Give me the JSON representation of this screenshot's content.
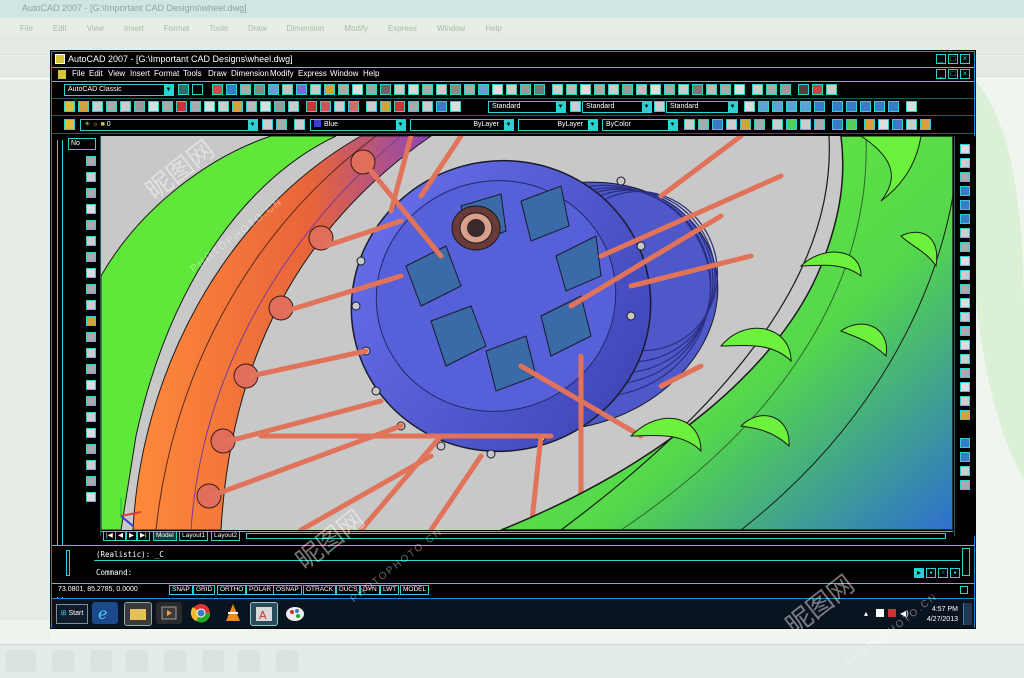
{
  "window": {
    "title": "AutoCAD 2007 - [G:\\Important CAD Designs\\wheel.dwg]",
    "background_title": "AutoCAD 2007 - [G:\\Important CAD Designs\\wheel.dwg]"
  },
  "menu": [
    "File",
    "Edit",
    "View",
    "Insert",
    "Format",
    "Tools",
    "Draw",
    "Dimension",
    "Modify",
    "Express",
    "Window",
    "Help"
  ],
  "toolbar": {
    "workspace": "AutoCAD Classic",
    "text_style": "Standard",
    "dim_style": "Standard",
    "table_style": "Standard",
    "layer": "0",
    "color": "Blue",
    "linetype": "ByLayer",
    "lineweight": "ByLayer",
    "plot_style": "ByColor"
  },
  "left_toolbar": {
    "label": "No"
  },
  "layout_tabs": [
    "Model",
    "Layout1",
    "Layout2"
  ],
  "command": {
    "history": "(Realistic):  _C",
    "prompt": "Command:"
  },
  "status": {
    "coordinates": "73.0801, 85.2785, 0.0000",
    "buttons": [
      "SNAP",
      "GRID",
      "ORTHO",
      "POLAR",
      "OSNAP",
      "OTRACK",
      "DUCS",
      "DYN",
      "LWT",
      "MODEL"
    ]
  },
  "taskbar": {
    "start": "Start",
    "time": "4:57 PM",
    "date": "4/27/2013"
  },
  "watermark": {
    "glyph": "昵图网",
    "text": "PHOTOPHOTO.CN"
  },
  "colors": {
    "accent": "#2dd1d1",
    "tire_green": "#5fe83a",
    "hub_blue": "#5a62d8",
    "rim_orange": "#e8643a",
    "spoke": "#e0735a",
    "viewport_bg": "#c8c8c8"
  },
  "icons": [
    "autocad-icon",
    "start-orb-icon",
    "ie-icon",
    "explorer-icon",
    "media-player-icon",
    "chrome-icon",
    "vlc-icon",
    "autocad-taskbar-icon",
    "paint-icon",
    "ucs-icon"
  ]
}
